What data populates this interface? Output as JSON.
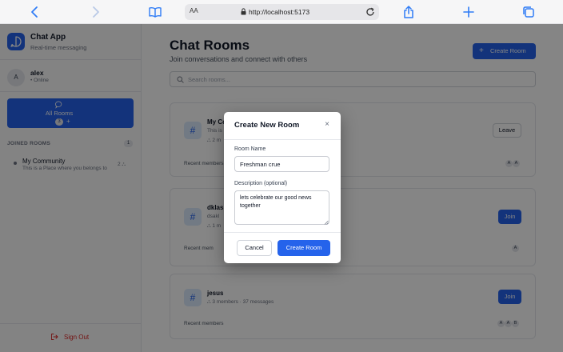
{
  "browser": {
    "text_size_label": "AA",
    "url": "http://localhost:5173"
  },
  "sidebar": {
    "app_name": "Chat App",
    "app_tagline": "Real-time messaging",
    "user": {
      "avatar_initial": "A",
      "name": "alex",
      "status": "• Online"
    },
    "all_rooms": {
      "label": "All Rooms",
      "count": "3",
      "plus": "+"
    },
    "joined_rooms": {
      "title": "JOINED ROOMS",
      "count": "1",
      "items": [
        {
          "name": "My Community",
          "description": "This is a Place where you belongs to",
          "members": "2 ⛬"
        }
      ]
    },
    "sign_out_label": "Sign Out"
  },
  "main": {
    "title": "Chat Rooms",
    "subtitle": "Join conversations and connect with others",
    "create_room_label": "Create Room",
    "search_placeholder": "Search rooms...",
    "rooms": [
      {
        "icon": "#",
        "name": "My Co",
        "description": "This is",
        "meta": "⛬ 2 m",
        "recent_label": "Recent members",
        "avatars": [
          "A",
          "A"
        ],
        "action": "Leave"
      },
      {
        "icon": "#",
        "name": "dklas",
        "description": "dsakl",
        "meta": "⛬ 1 m",
        "recent_label": "Recent mem",
        "avatars": [
          "A"
        ],
        "action": "Join"
      },
      {
        "icon": "#",
        "name": "jesus",
        "description": "",
        "meta": "⛬ 3 members · 37 messages",
        "recent_label": "Recent members",
        "avatars": [
          "A",
          "A",
          "B"
        ],
        "action": "Join"
      }
    ]
  },
  "modal": {
    "title": "Create New Room",
    "close_symbol": "×",
    "name_label": "Room Name",
    "name_value": "Freshman crue",
    "description_label": "Description (optional)",
    "description_value": "lets celebrate our good news together",
    "cancel_label": "Cancel",
    "submit_label": "Create Room"
  },
  "colors": {
    "accent": "#2563eb",
    "danger": "#dc2626",
    "overlay": "rgba(0,0,0,0.48)"
  }
}
